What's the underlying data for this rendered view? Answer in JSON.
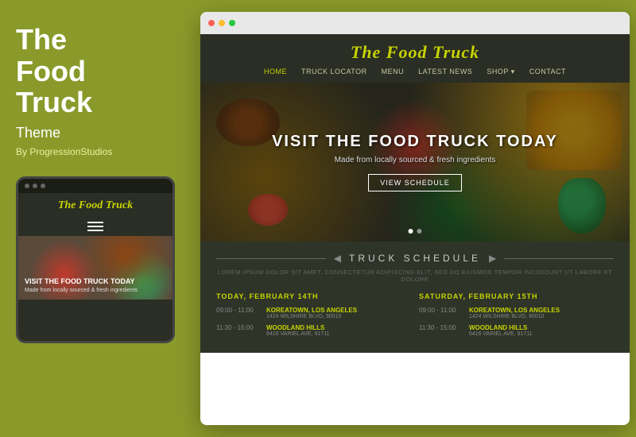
{
  "leftPanel": {
    "title": "The\nFood\nTruck",
    "titleLine1": "The",
    "titleLine2": "Food",
    "titleLine3": "Truck",
    "themeLabel": "Theme",
    "byLine": "By ProgressionStudios"
  },
  "mobileMockup": {
    "title": "The Food Truck",
    "heroText": "VISIT THE FOOD TRUCK TODAY",
    "heroSub": "Made from locally sourced & fresh ingredients"
  },
  "desktopMockup": {
    "siteTitle": "The Food Truck",
    "nav": {
      "items": [
        {
          "label": "HOME",
          "active": true
        },
        {
          "label": "TRUCK LOCATOR",
          "active": false
        },
        {
          "label": "MENU",
          "active": false
        },
        {
          "label": "LATEST NEWS",
          "active": false
        },
        {
          "label": "SHOP",
          "active": false
        },
        {
          "label": "CONTACT",
          "active": false
        }
      ]
    },
    "hero": {
      "title": "VISIT THE FOOD TRUCK TODAY",
      "subtitle": "Made from locally sourced & fresh ingredients",
      "buttonLabel": "View Schedule"
    },
    "schedule": {
      "sectionTitle": "TRUCK SCHEDULE",
      "description": "LOREM IPSUM DOLOR SIT AMET, CONSECTETUR ADIPISCING ELIT, SED DO EIUSMOD TEMPOR INCIDIDUNT UT LABORE ET DOLORE",
      "columns": [
        {
          "dayTitle": "TODAY, FEBRUARY 14TH",
          "items": [
            {
              "time": "09:00 - 11:00",
              "locationName": "KOREATOWN, LOS ANGELES",
              "locationAddr": "1424 WILSHIRE BLVD, 90010"
            },
            {
              "time": "11:30 - 15:00",
              "locationName": "WOODLAND HILLS",
              "locationAddr": "6416 VARIEL AVE, 91711"
            }
          ]
        },
        {
          "dayTitle": "SATURDAY, FEBRUARY 15TH",
          "items": [
            {
              "time": "09:00 - 11:00",
              "locationName": "KOREATOWN, LOS ANGELES",
              "locationAddr": "1424 WILSHIRE BLVD, 90010"
            },
            {
              "time": "11:30 - 15:00",
              "locationName": "WOODLAND HILLS",
              "locationAddr": "6416 VARIEL AVE, 91711"
            }
          ]
        }
      ]
    }
  },
  "colors": {
    "accent": "#c8d400",
    "bgOlive": "#8a9a2a",
    "darkBg": "#2a2e24"
  }
}
